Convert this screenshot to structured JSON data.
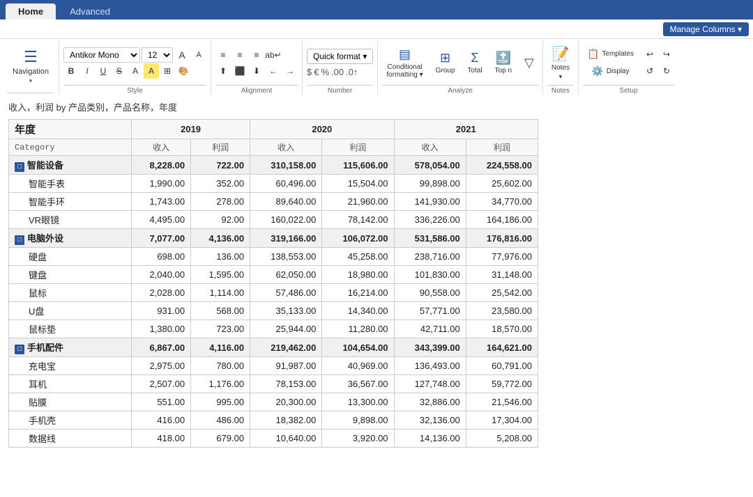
{
  "tabs": [
    {
      "label": "Home",
      "active": true
    },
    {
      "label": "Advanced",
      "active": false
    }
  ],
  "ribbon": {
    "manage_columns": "Manage Columns ▾",
    "navigation": {
      "icon": "≡",
      "label": "Navigation",
      "chevron": "▾"
    },
    "style": {
      "font": "Antikor Mono",
      "font_size": "12",
      "label": "Style"
    },
    "alignment": {
      "label": "Alignment"
    },
    "number": {
      "label": "Number",
      "quick_format": "Quick format ▾",
      "symbols": [
        "$",
        "€",
        "%",
        ".00",
        "↑.00"
      ]
    },
    "analyze": {
      "label": "Analyze",
      "conditional_formatting": "Conditional formatting ▾",
      "group": "Group",
      "total": "Total",
      "top_n": "Top n",
      "filter": "▽"
    },
    "notes": {
      "label": "Notes",
      "notes": "Notes",
      "notes_icon": "📝"
    },
    "setup": {
      "label": "Setup",
      "templates": "Templates",
      "display": "Display",
      "undo": "↩",
      "redo": "↪",
      "refresh": "↺",
      "repeat": "↻"
    }
  },
  "breadcrumb": "收入，利润 by 产品类别，产品名称，年度",
  "table": {
    "year_label": "年度",
    "years": [
      "2019",
      "2020",
      "2021"
    ],
    "category_col": "Category",
    "columns": [
      "收入",
      "利润",
      "收入",
      "利润",
      "收入",
      "利润"
    ],
    "groups": [
      {
        "name": "智能设备",
        "values": [
          "8,228.00",
          "722.00",
          "310,158.00",
          "115,606.00",
          "578,054.00",
          "224,558.00"
        ],
        "children": [
          {
            "name": "智能手表",
            "values": [
              "1,990.00",
              "352.00",
              "60,496.00",
              "15,504.00",
              "99,898.00",
              "25,602.00"
            ]
          },
          {
            "name": "智能手环",
            "values": [
              "1,743.00",
              "278.00",
              "89,640.00",
              "21,960.00",
              "141,930.00",
              "34,770.00"
            ]
          },
          {
            "name": "VR眼镜",
            "values": [
              "4,495.00",
              "92.00",
              "160,022.00",
              "78,142.00",
              "336,226.00",
              "164,186.00"
            ]
          }
        ]
      },
      {
        "name": "电脑外设",
        "values": [
          "7,077.00",
          "4,136.00",
          "319,166.00",
          "106,072.00",
          "531,586.00",
          "176,816.00"
        ],
        "children": [
          {
            "name": "硬盘",
            "values": [
              "698.00",
              "136.00",
              "138,553.00",
              "45,258.00",
              "238,716.00",
              "77,976.00"
            ]
          },
          {
            "name": "键盘",
            "values": [
              "2,040.00",
              "1,595.00",
              "62,050.00",
              "18,980.00",
              "101,830.00",
              "31,148.00"
            ]
          },
          {
            "name": "鼠标",
            "values": [
              "2,028.00",
              "1,114.00",
              "57,486.00",
              "16,214.00",
              "90,558.00",
              "25,542.00"
            ]
          },
          {
            "name": "U盘",
            "values": [
              "931.00",
              "568.00",
              "35,133.00",
              "14,340.00",
              "57,771.00",
              "23,580.00"
            ]
          },
          {
            "name": "鼠标垫",
            "values": [
              "1,380.00",
              "723.00",
              "25,944.00",
              "11,280.00",
              "42,711.00",
              "18,570.00"
            ]
          }
        ]
      },
      {
        "name": "手机配件",
        "values": [
          "6,867.00",
          "4,116.00",
          "219,462.00",
          "104,654.00",
          "343,399.00",
          "164,621.00"
        ],
        "children": [
          {
            "name": "充电宝",
            "values": [
              "2,975.00",
              "780.00",
              "91,987.00",
              "40,969.00",
              "136,493.00",
              "60,791.00"
            ]
          },
          {
            "name": "耳机",
            "values": [
              "2,507.00",
              "1,176.00",
              "78,153.00",
              "36,567.00",
              "127,748.00",
              "59,772.00"
            ]
          },
          {
            "name": "贴膜",
            "values": [
              "551.00",
              "995.00",
              "20,300.00",
              "13,300.00",
              "32,886.00",
              "21,546.00"
            ]
          },
          {
            "name": "手机壳",
            "values": [
              "416.00",
              "486.00",
              "18,382.00",
              "9,898.00",
              "32,136.00",
              "17,304.00"
            ]
          },
          {
            "name": "数据线",
            "values": [
              "418.00",
              "679.00",
              "10,640.00",
              "3,920.00",
              "14,136.00",
              "5,208.00"
            ]
          }
        ]
      }
    ]
  }
}
